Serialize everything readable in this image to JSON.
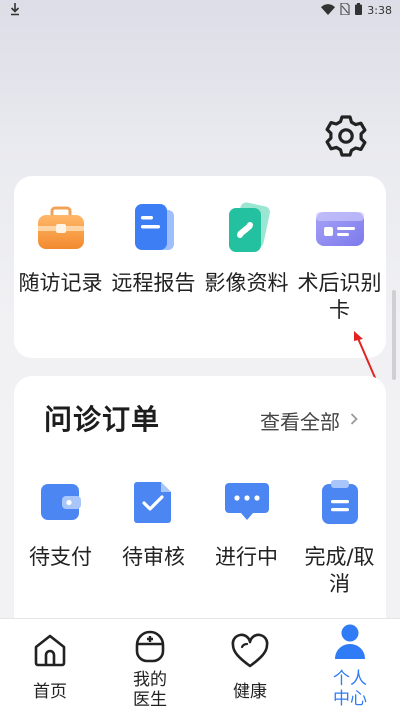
{
  "status_bar": {
    "time": "3:38",
    "icons": [
      "download-icon",
      "wifi-icon",
      "no-sim-icon",
      "battery-icon"
    ]
  },
  "header": {
    "settings_icon": "gear-icon"
  },
  "services": [
    {
      "label": "随访记录",
      "icon": "toolbox-icon",
      "color": "#f79a3e"
    },
    {
      "label": "远程报告",
      "icon": "report-icon",
      "color": "#3d7ef5"
    },
    {
      "label": "影像资料",
      "icon": "image-data-icon",
      "color": "#23c1a0"
    },
    {
      "label": "术后识别卡",
      "icon": "id-card-icon",
      "color": "#8d86f0"
    }
  ],
  "orders": {
    "title": "问诊订单",
    "view_all": "查看全部",
    "items": [
      {
        "label": "待支付",
        "icon": "wallet-icon"
      },
      {
        "label": "待审核",
        "icon": "review-check-icon"
      },
      {
        "label": "进行中",
        "icon": "chat-dots-icon"
      },
      {
        "label": "完成/取消",
        "icon": "clipboard-icon"
      }
    ]
  },
  "tabs": [
    {
      "label": "首页",
      "icon": "home-icon",
      "active": false
    },
    {
      "label": "我的医生",
      "icon": "doctor-icon",
      "active": false
    },
    {
      "label": "健康",
      "icon": "heart-icon",
      "active": false
    },
    {
      "label": "个人中心",
      "icon": "person-icon",
      "active": true
    }
  ],
  "colors": {
    "accent": "#2f7cf6",
    "annotation_arrow": "#e02424"
  }
}
